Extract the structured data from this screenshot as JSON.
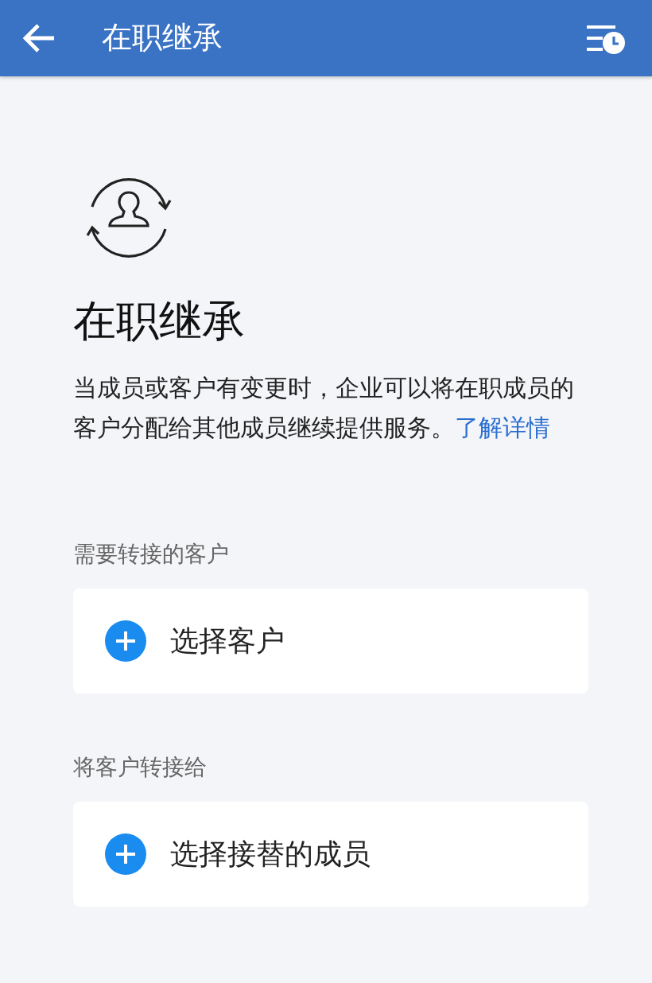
{
  "header": {
    "title": "在职继承"
  },
  "intro": {
    "title": "在职继承",
    "description": "当成员或客户有变更时，企业可以将在职成员的客户分配给其他成员继续提供服务。",
    "link": "了解详情"
  },
  "sections": [
    {
      "label": "需要转接的客户",
      "action": "选择客户"
    },
    {
      "label": "将客户转接给",
      "action": "选择接替的成员"
    }
  ]
}
